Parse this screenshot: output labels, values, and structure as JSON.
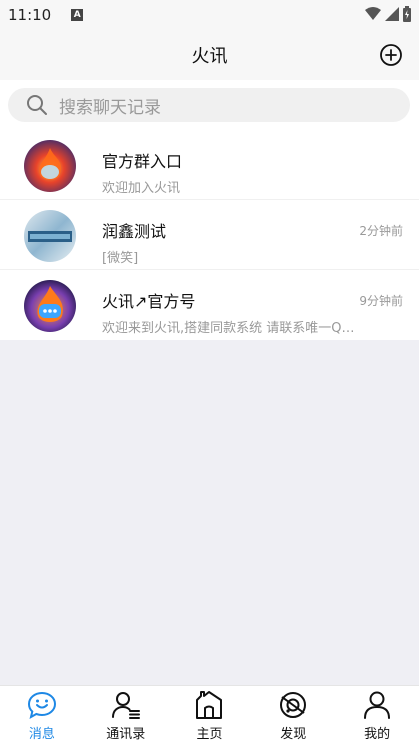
{
  "status": {
    "time": "11:10",
    "badge": "A"
  },
  "header": {
    "title": "火讯"
  },
  "search": {
    "placeholder": "搜索聊天记录"
  },
  "chats": [
    {
      "name": "官方群入口",
      "message": "欢迎加入火讯",
      "time": ""
    },
    {
      "name": "润鑫测试",
      "message": "[微笑]",
      "time": "2分钟前"
    },
    {
      "name": "火讯↗官方号",
      "message": "欢迎来到火讯,搭建同款系统 请联系唯一Q…",
      "time": "9分钟前"
    }
  ],
  "tabs": [
    {
      "label": "消息",
      "icon": "chat-bubble-icon"
    },
    {
      "label": "通讯录",
      "icon": "contacts-icon"
    },
    {
      "label": "主页",
      "icon": "home-icon"
    },
    {
      "label": "发现",
      "icon": "discover-icon"
    },
    {
      "label": "我的",
      "icon": "profile-icon"
    }
  ],
  "colors": {
    "accent": "#1e88e5",
    "background": "#efeff4"
  }
}
